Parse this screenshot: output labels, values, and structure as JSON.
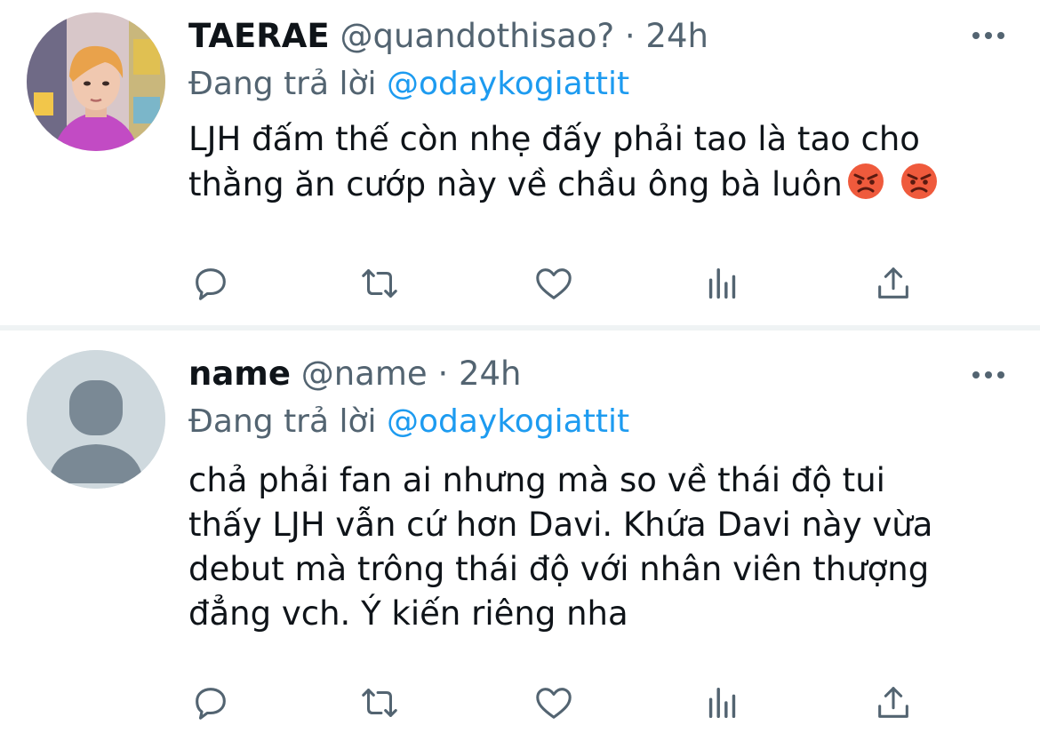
{
  "tweets": [
    {
      "display_name": "TAERAE",
      "handle": "@quandothisao?",
      "separator": "·",
      "time": "24h",
      "replying_label": "Đang trả lời",
      "replying_to": "@odaykogiattit",
      "text": "LJH đấm thế còn nhẹ đấy phải tao là tao cho\nthằng ăn cướp này về chầu ông bà luôn",
      "emojis": [
        "angry-face-emoji",
        "angry-face-emoji"
      ],
      "avatar": "profile-photo"
    },
    {
      "display_name": "name",
      "handle": "@name",
      "separator": "·",
      "time": "24h",
      "replying_label": "Đang trả lời",
      "replying_to": "@odaykogiattit",
      "text": "chả phải fan ai nhưng mà so về thái độ tui\nthấy LJH vẫn cứ hơn Davi. Khứa Davi này vừa\ndebut mà trông thái độ với nhân viên thượng\nđẳng vch. Ý kiến riêng nha",
      "avatar": "default-avatar"
    }
  ],
  "actions": [
    "reply-icon",
    "retweet-icon",
    "like-icon",
    "analytics-icon",
    "share-icon"
  ],
  "colors": {
    "text": "#0f1419",
    "secondary": "#536471",
    "accent": "#1d9bf0",
    "divider": "#eff3f4",
    "default_avatar_bg": "#cfd9de",
    "default_avatar_fg": "#7a8995"
  }
}
